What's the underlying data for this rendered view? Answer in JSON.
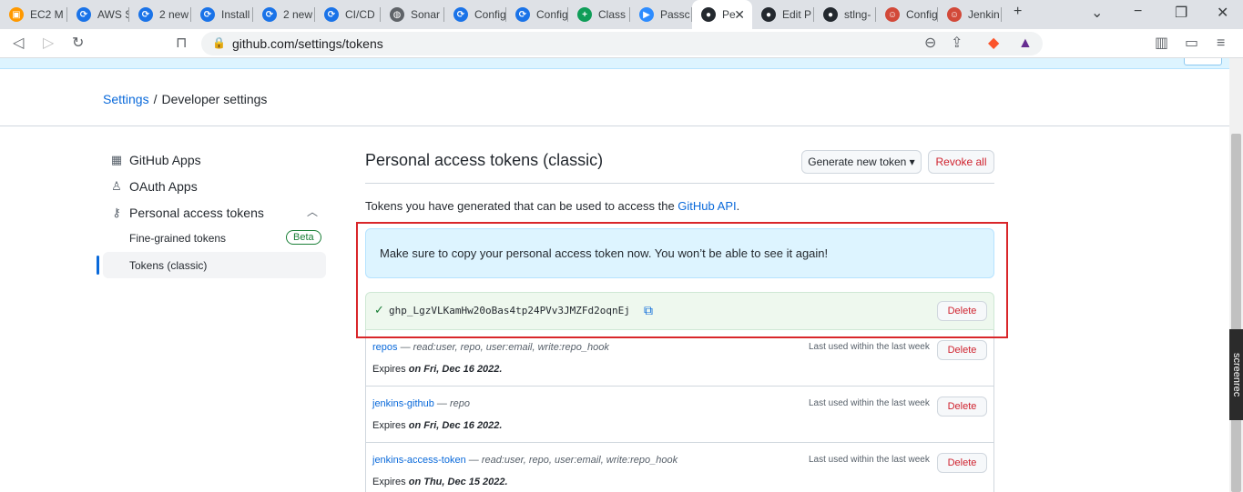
{
  "tabs": [
    {
      "label": "EC2 M",
      "icon": "aws-icon",
      "color": "#ff9900"
    },
    {
      "label": "AWS S",
      "icon": "devops-icon",
      "color": "#1a73e8"
    },
    {
      "label": "2 new",
      "icon": "devops-icon",
      "color": "#1a73e8"
    },
    {
      "label": "Install",
      "icon": "devops-icon",
      "color": "#1a73e8"
    },
    {
      "label": "2 new",
      "icon": "devops-icon",
      "color": "#1a73e8"
    },
    {
      "label": "CI/CD",
      "icon": "devops-icon",
      "color": "#1a73e8"
    },
    {
      "label": "Sonar",
      "icon": "globe-icon",
      "color": "#5f6368"
    },
    {
      "label": "Config",
      "icon": "devops-icon",
      "color": "#1a73e8"
    },
    {
      "label": "Config",
      "icon": "devops-icon",
      "color": "#1a73e8"
    },
    {
      "label": "Class",
      "icon": "classroom-icon",
      "color": "#0f9d58"
    },
    {
      "label": "Passc",
      "icon": "zoom-icon",
      "color": "#2d8cff"
    },
    {
      "label": "Pe",
      "icon": "github-icon",
      "color": "#24292f",
      "active": true
    },
    {
      "label": "Edit P",
      "icon": "github-icon",
      "color": "#24292f"
    },
    {
      "label": "stlng-",
      "icon": "github-icon",
      "color": "#24292f"
    },
    {
      "label": "Config",
      "icon": "jenkins-icon",
      "color": "#d24939"
    },
    {
      "label": "Jenkin",
      "icon": "jenkins-icon",
      "color": "#d24939"
    }
  ],
  "address": {
    "url": "github.com/settings/tokens"
  },
  "breadcrumb": {
    "settings": "Settings",
    "sep": "/",
    "current": "Developer settings"
  },
  "sidebar": {
    "github_apps": "GitHub Apps",
    "oauth_apps": "OAuth Apps",
    "personal_access_tokens": "Personal access tokens",
    "fine_grained": "Fine-grained tokens",
    "beta": "Beta",
    "tokens_classic": "Tokens (classic)"
  },
  "main": {
    "title": "Personal access tokens (classic)",
    "generate_button": "Generate new token ▾",
    "revoke_all": "Revoke all",
    "intro_prefix": "Tokens you have generated that can be used to access the ",
    "intro_link": "GitHub API",
    "intro_suffix": ".",
    "notice": "Make sure to copy your personal access token now. You won’t be able to see it again!",
    "new_token": "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",
    "delete": "Delete"
  },
  "tokens": [
    {
      "name": "repos",
      "scopes": "read:user, repo, user:email, write:repo_hook",
      "expires_prefix": "Expires ",
      "expires": "on Fri, Dec 16 2022.",
      "last_used": "Last used within the last week",
      "delete": "Delete"
    },
    {
      "name": "jenkins-github",
      "scopes": "repo",
      "expires_prefix": "Expires ",
      "expires": "on Fri, Dec 16 2022.",
      "last_used": "Last used within the last week",
      "delete": "Delete"
    },
    {
      "name": "jenkins-access-token",
      "scopes": "read:user, repo, user:email, write:repo_hook",
      "expires_prefix": "Expires ",
      "expires": "on Thu, Dec 15 2022.",
      "last_used": "Last used within the last week",
      "delete": "Delete"
    }
  ],
  "overlay": {
    "screenrec": "screenrec"
  },
  "colors": {
    "link": "#0969da",
    "danger": "#cf222e",
    "success": "#1a7f37",
    "highlight": "#d9262a"
  }
}
